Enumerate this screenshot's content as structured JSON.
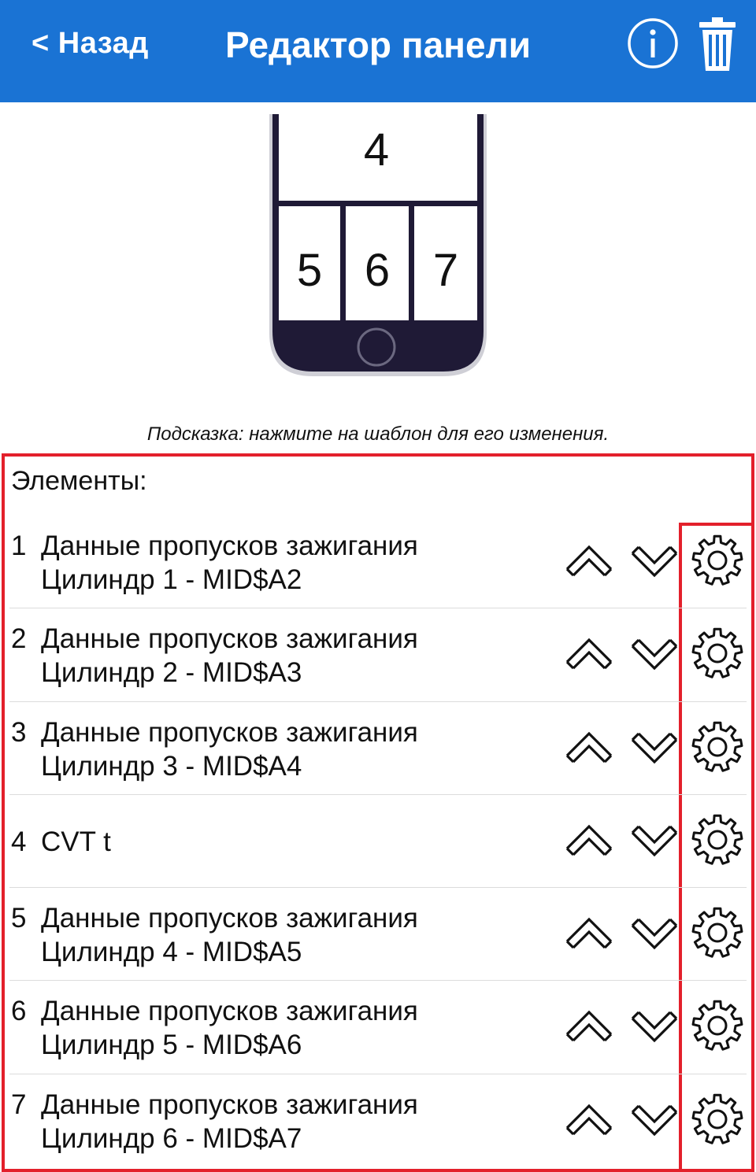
{
  "header": {
    "back_label": "< Назад",
    "title": "Редактор панели",
    "info_icon": "info-icon",
    "trash_icon": "trash-icon",
    "bg_color": "#1a73d4"
  },
  "preview": {
    "top_slot": "4",
    "bottom_slots": [
      "5",
      "6",
      "7"
    ]
  },
  "hint": "Подсказка: нажмите на шаблон для его изменения.",
  "elements": {
    "title": "Элементы:",
    "items": [
      {
        "num": "1",
        "line1": "Данные пропусков зажигания",
        "line2": "Цилиндр 1 - MID$A2"
      },
      {
        "num": "2",
        "line1": "Данные пропусков зажигания",
        "line2": "Цилиндр 2 - MID$A3"
      },
      {
        "num": "3",
        "line1": "Данные пропусков зажигания",
        "line2": "Цилиндр 3 - MID$A4"
      },
      {
        "num": "4",
        "line1": "CVT t",
        "line2": ""
      },
      {
        "num": "5",
        "line1": "Данные пропусков зажигания",
        "line2": "Цилиндр 4 - MID$A5"
      },
      {
        "num": "6",
        "line1": "Данные пропусков зажигания",
        "line2": "Цилиндр 5 - MID$A6"
      },
      {
        "num": "7",
        "line1": "Данные пропусков зажигания",
        "line2": "Цилиндр 6 - MID$A7"
      }
    ]
  },
  "highlight_color": "#e3202b"
}
